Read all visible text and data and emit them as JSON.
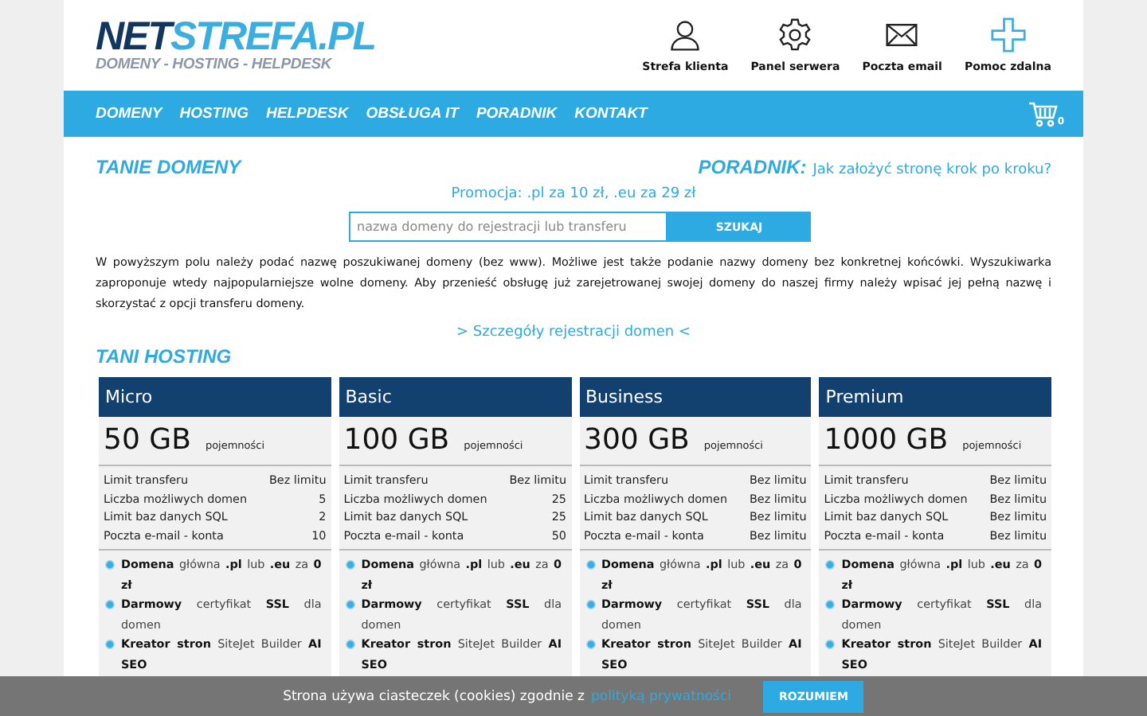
{
  "logo": {
    "part_dark": "NET",
    "part_light": "STREFA.PL",
    "tagline": "DOMENY - HOSTING - HELPDESK"
  },
  "top_links": [
    {
      "kind": "user",
      "label": "Strefa klienta"
    },
    {
      "kind": "gear",
      "label": "Panel serwera"
    },
    {
      "kind": "mail",
      "label": "Poczta email"
    },
    {
      "kind": "plus",
      "label": "Pomoc zdalna"
    }
  ],
  "nav": {
    "items": [
      "DOMENY",
      "HOSTING",
      "HELPDESK",
      "OBSŁUGA IT",
      "PORADNIK",
      "KONTAKT"
    ],
    "cart_count": "0"
  },
  "domains": {
    "heading": "TANIE DOMENY",
    "guide_label": "PORADNIK:",
    "guide_link": "Jak założyć stronę krok po kroku?",
    "promo": "Promocja: .pl za 10 zł, .eu za 29 zł",
    "search": {
      "placeholder": "nazwa domeny do rejestracji lub transferu",
      "button": "SZUKAJ"
    },
    "description": "W powyższym polu należy podać nazwę poszukiwanej domeny (bez www). Możliwe jest także podanie nazwy domeny bez konkretnej końcówki. Wyszukiwarka zaproponuje wtedy najpopularniejsze wolne domeny. Aby przenieść obsługę już zarejetrowanej swojej domeny do naszej firmy należy wpisać jej pełną nazwę i skorzystać z opcji transferu domeny.",
    "details_link": "> Szczegóły rejestracji domen <"
  },
  "hosting": {
    "heading": "TANI HOSTING",
    "plans": [
      {
        "name": "Micro",
        "capacity": "50 GB",
        "capacity_label": "pojemności",
        "specs": [
          [
            "Limit transferu",
            "Bez limitu"
          ],
          [
            "Liczba możliwych domen",
            "5"
          ],
          [
            "Limit baz danych SQL",
            "2"
          ],
          [
            "Poczta e-mail - konta",
            "10"
          ]
        ],
        "features": [
          "**Domena** główna **.pl** lub **.eu** za **0 zł**",
          "**Darmowy** certyfikat **SSL** dla domen",
          "**Kreator stron** SiteJet Builder **AI SEO**"
        ]
      },
      {
        "name": "Basic",
        "capacity": "100 GB",
        "capacity_label": "pojemności",
        "specs": [
          [
            "Limit transferu",
            "Bez limitu"
          ],
          [
            "Liczba możliwych domen",
            "25"
          ],
          [
            "Limit baz danych SQL",
            "25"
          ],
          [
            "Poczta e-mail - konta",
            "50"
          ]
        ],
        "features": [
          "**Domena** główna **.pl** lub **.eu** za **0 zł**",
          "**Darmowy** certyfikat **SSL** dla domen",
          "**Kreator stron** SiteJet Builder **AI SEO**"
        ]
      },
      {
        "name": "Business",
        "capacity": "300 GB",
        "capacity_label": "pojemności",
        "specs": [
          [
            "Limit transferu",
            "Bez limitu"
          ],
          [
            "Liczba możliwych domen",
            "Bez limitu"
          ],
          [
            "Limit baz danych SQL",
            "Bez limitu"
          ],
          [
            "Poczta e-mail - konta",
            "Bez limitu"
          ]
        ],
        "features": [
          "**Domena** główna **.pl** lub **.eu** za **0 zł**",
          "**Darmowy** certyfikat **SSL** dla domen",
          "**Kreator stron** SiteJet Builder **AI SEO**"
        ]
      },
      {
        "name": "Premium",
        "capacity": "1000 GB",
        "capacity_label": "pojemności",
        "specs": [
          [
            "Limit transferu",
            "Bez limitu"
          ],
          [
            "Liczba możliwych domen",
            "Bez limitu"
          ],
          [
            "Limit baz danych SQL",
            "Bez limitu"
          ],
          [
            "Poczta e-mail - konta",
            "Bez limitu"
          ]
        ],
        "features": [
          "**Domena** główna **.pl** lub **.eu** za **0 zł**",
          "**Darmowy** certyfikat **SSL** dla domen",
          "**Kreator stron** SiteJet Builder **AI SEO**"
        ]
      }
    ]
  },
  "cookie_bar": {
    "text": "Strona używa ciasteczek (cookies) zgodnie z",
    "link": "polityką prywatności",
    "button": "ROZUMIEM"
  }
}
